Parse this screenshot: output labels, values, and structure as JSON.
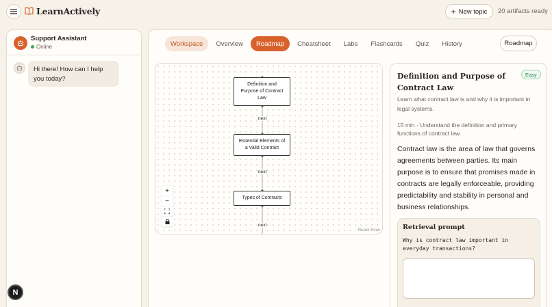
{
  "app": {
    "brand": "LearnActively",
    "new_topic_label": "New topic",
    "artifacts_status": "20 artifacts ready"
  },
  "chat": {
    "assistant_name": "Support Assistant",
    "status": "Online",
    "messages": [
      {
        "role": "assistant",
        "text": "Hi there! How can I help you today?"
      }
    ],
    "badge_letter": "N"
  },
  "tabs": [
    {
      "label": "Workspace"
    },
    {
      "label": "Overview"
    },
    {
      "label": "Roadmap"
    },
    {
      "label": "Cheatsheet"
    },
    {
      "label": "Labs"
    },
    {
      "label": "Flashcards"
    },
    {
      "label": "Quiz"
    },
    {
      "label": "History"
    }
  ],
  "active_tab": "Roadmap",
  "view_chip": "Roadmap",
  "roadmap": {
    "nodes": [
      {
        "label": "Definition and Purpose of Contract Law"
      },
      {
        "label": "Essential Elements of a Valid Contract"
      },
      {
        "label": "Types of Contracts"
      }
    ],
    "edge_label": "next",
    "attribution": "React Flow",
    "controls": [
      "zoom-in",
      "zoom-out",
      "fit-view",
      "lock"
    ]
  },
  "detail": {
    "title": "Definition and Purpose of Contract Law",
    "difficulty": "Easy",
    "description": "Learn what contract law is and why it is important in legal systems.",
    "meta": "15 min · Understand the definition and primary functions of contract law.",
    "body": "Contract law is the area of law that governs agreements between parties. Its main purpose is to ensure that promises made in contracts are legally enforceable, providing predictability and stability in personal and business relationships.",
    "retrieval_title": "Retrieval prompt",
    "retrieval_question": "Why is contract law important in everyday transactions?",
    "answer_value": ""
  },
  "colors": {
    "accent": "#d9612b",
    "background": "#f6f1e9",
    "online": "#3fa35a",
    "easy": "#2f8a48"
  }
}
